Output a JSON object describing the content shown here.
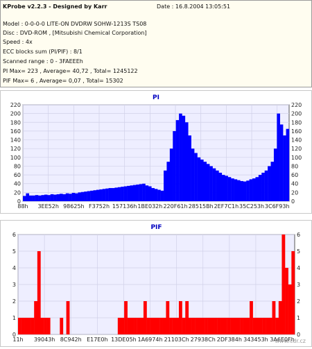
{
  "info": {
    "title": "KProbe v2.2.3 - Designed by Karr",
    "date": "Date : 16.8.2004 13:05:51",
    "lines": [
      "Model : 0-0-0-0 LITE-ON DVDRW SOHW-1213S TS08",
      "Disc : DVD-ROM , [Mitsubishi Chemical Corporation]",
      "Speed : 4x",
      "ECC blocks sum (PI/PIF) : 8/1",
      "Scanned range : 0 - 3FAEEEh",
      "PI Max= 223 , Average= 40,72 , Total= 1245122",
      "PIF Max= 6 , Average= 0,07 , Total= 15302"
    ]
  },
  "watermark": "www.cdr.cz",
  "colors": {
    "bar": "#0000ff",
    "bar_pif": "#ff0000",
    "title": "#0000c0",
    "plot_bg": "#eeeeff",
    "info_bg": "#fffdf0"
  },
  "chart_data": [
    {
      "type": "bar",
      "title": "PI",
      "ylim": [
        0,
        220
      ],
      "yticks": [
        "0",
        "20",
        "40",
        "60",
        "80",
        "100",
        "120",
        "140",
        "160",
        "180",
        "200",
        "220"
      ],
      "xticks": [
        "88h",
        "3EE52h",
        "98625h",
        "F3752h",
        "157136h",
        "1BE032h",
        "220F61h",
        "28515Bh",
        "2EF7C1h",
        "35C253h",
        "3C6F93h"
      ],
      "grid": true,
      "series": [
        {
          "values": [
            12,
            18,
            13,
            13,
            14,
            13,
            14,
            15,
            14,
            16,
            15,
            16,
            17,
            16,
            18,
            17,
            19,
            18,
            20,
            21,
            22,
            23,
            24,
            25,
            26,
            27,
            28,
            29,
            30,
            30,
            31,
            32,
            33,
            34,
            35,
            36,
            37,
            38,
            39,
            40,
            36,
            34,
            30,
            28,
            26,
            24,
            70,
            90,
            120,
            160,
            185,
            200,
            195,
            180,
            150,
            120,
            110,
            100,
            95,
            90,
            85,
            80,
            75,
            70,
            65,
            60,
            58,
            55,
            52,
            50,
            48,
            46,
            45,
            47,
            50,
            52,
            55,
            60,
            65,
            70,
            80,
            90,
            120,
            200,
            175,
            150,
            165
          ]
        }
      ]
    },
    {
      "type": "bar",
      "title": "PIF",
      "ylim": [
        0,
        6
      ],
      "yticks": [
        "0",
        "1",
        "2",
        "3",
        "4",
        "5",
        "6"
      ],
      "xticks": [
        "11h",
        "39043h",
        "8C942h",
        "E17E0h",
        "13DE05h",
        "1A6974h",
        "21103Ch",
        "27938Ch",
        "2DF384h",
        "343453h",
        "3A6E0Fh"
      ],
      "grid": true,
      "series": [
        {
          "values": [
            1,
            1,
            1,
            1,
            1,
            2,
            5,
            1,
            1,
            1,
            0,
            0,
            0,
            1,
            0,
            2,
            0,
            0,
            0,
            0,
            0,
            0,
            0,
            0,
            0,
            0,
            0,
            0,
            0,
            0,
            0,
            1,
            1,
            2,
            1,
            1,
            1,
            1,
            1,
            2,
            1,
            1,
            1,
            1,
            1,
            1,
            2,
            1,
            1,
            1,
            2,
            1,
            2,
            1,
            1,
            1,
            1,
            1,
            1,
            1,
            1,
            1,
            1,
            1,
            1,
            1,
            1,
            1,
            1,
            1,
            1,
            1,
            2,
            1,
            1,
            1,
            1,
            1,
            1,
            2,
            1,
            2,
            6,
            4,
            3,
            5
          ]
        }
      ]
    }
  ]
}
